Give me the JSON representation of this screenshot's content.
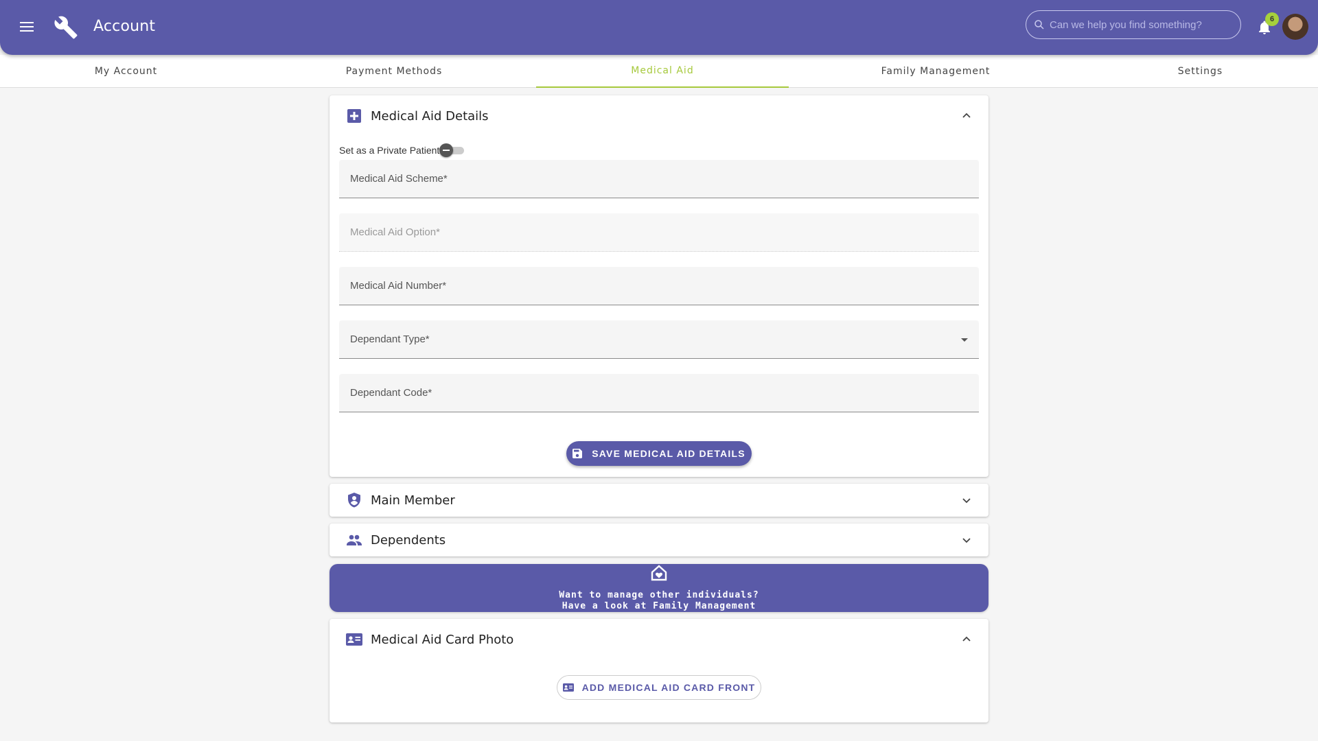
{
  "header": {
    "title": "Account",
    "search_placeholder": "Can we help you find something?",
    "notification_count": "6"
  },
  "tabs": [
    {
      "label": "My Account"
    },
    {
      "label": "Payment Methods"
    },
    {
      "label": "Medical Aid",
      "active": true
    },
    {
      "label": "Family Management"
    },
    {
      "label": "Settings"
    }
  ],
  "medical_aid_details": {
    "title": "Medical Aid Details",
    "private_patient_label": "Set as a Private Patient",
    "private_patient_enabled": false,
    "fields": {
      "scheme": "Medical Aid Scheme*",
      "option": "Medical Aid Option*",
      "number": "Medical Aid Number*",
      "dependant_type": "Dependant Type*",
      "dependant_code": "Dependant Code*"
    },
    "save_label": "SAVE MEDICAL AID DETAILS"
  },
  "main_member": {
    "title": "Main Member"
  },
  "dependents": {
    "title": "Dependents"
  },
  "family_banner": {
    "line1": "Want to manage other individuals?",
    "line2": "Have a look at Family Management"
  },
  "card_photo": {
    "title": "Medical Aid Card Photo",
    "add_front_label": "ADD MEDICAL AID CARD FRONT"
  },
  "colors": {
    "primary": "#5a5aa8",
    "accent": "#a6c93c"
  }
}
